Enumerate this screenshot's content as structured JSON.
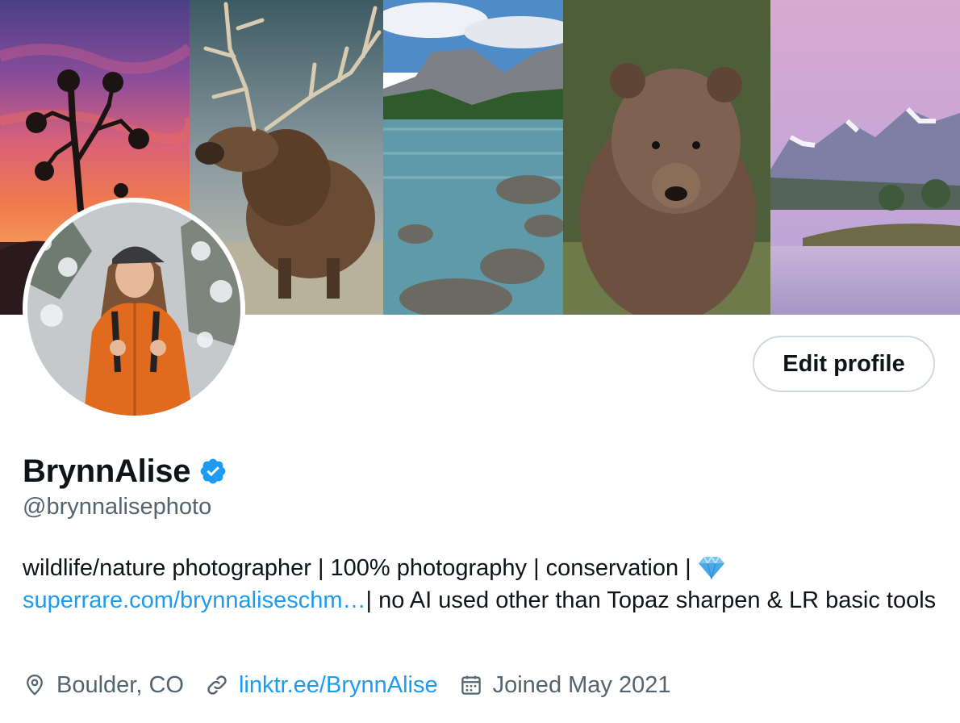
{
  "banner": {
    "panels": [
      "joshua-tree-sunset",
      "elk",
      "mountain-lake",
      "grizzly-bear",
      "mountain-reflection"
    ]
  },
  "profile": {
    "display_name": "BrynnAlise",
    "handle": "@brynnalisephoto",
    "edit_button_label": "Edit profile",
    "verified": true
  },
  "bio": {
    "text_1": "wildlife/nature photographer | 100% photography | conservation | ",
    "gem_icon": "gem-icon",
    "link_text": "superrare.com/brynnaliseschm…",
    "text_2": "| no AI used other than Topaz sharpen & LR basic tools"
  },
  "meta": {
    "location": "Boulder, CO",
    "website": "linktr.ee/BrynnAlise",
    "joined": "Joined May 2021"
  },
  "colors": {
    "accent": "#1d9bf0",
    "text_primary": "#0f1419",
    "text_secondary": "#536471",
    "border": "#cfd9de"
  }
}
